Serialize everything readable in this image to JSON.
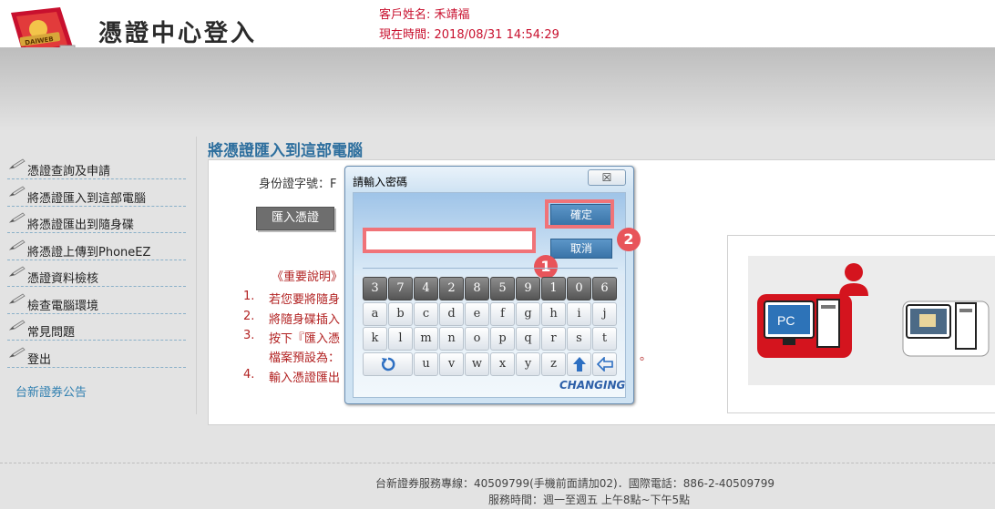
{
  "header": {
    "logo_text": "DAIWEB",
    "title": "憑證中心登入",
    "customer_label": "客戶姓名: 禾靖福",
    "time_label": "現在時間: 2018/08/31 14:54:29"
  },
  "sidebar": {
    "items": [
      {
        "label": "憑證查詢及申請"
      },
      {
        "label": "將憑證匯入到這部電腦"
      },
      {
        "label": "將憑證匯出到隨身碟"
      },
      {
        "label": "將憑證上傳到PhoneEZ"
      },
      {
        "label": "憑證資料檢核"
      },
      {
        "label": "檢查電腦環境"
      },
      {
        "label": "常見問題"
      },
      {
        "label": "登出"
      }
    ],
    "announcement": "台新證券公告"
  },
  "main": {
    "title": "將憑證匯入到這部電腦",
    "id_label": "身份證字號：F",
    "import_button": "匯入憑證",
    "notes_title": "《重要說明》",
    "notes": [
      {
        "num": "1.",
        "text": "若您要將隨身"
      },
      {
        "num": "2.",
        "text": "將隨身碟插入"
      },
      {
        "num": "3.",
        "text": "按下『匯入憑"
      },
      {
        "num": "",
        "text": "檔案預設為："
      },
      {
        "num": "4.",
        "text": "輸入憑證匯出"
      }
    ],
    "note_tail": "。",
    "illustration": {
      "pc_label": "PC"
    }
  },
  "dialog": {
    "title": "請輸入密碼",
    "close_glyph": "☒",
    "ok": "確定",
    "cancel": "取消",
    "password_value": "",
    "badges": [
      "1",
      "2"
    ],
    "digits": [
      "3",
      "7",
      "4",
      "2",
      "8",
      "5",
      "9",
      "1",
      "0",
      "6"
    ],
    "row2": [
      "a",
      "b",
      "c",
      "d",
      "e",
      "f",
      "g",
      "h",
      "i",
      "j"
    ],
    "row3": [
      "k",
      "l",
      "m",
      "n",
      "o",
      "p",
      "q",
      "r",
      "s",
      "t"
    ],
    "row4": [
      "u",
      "v",
      "w",
      "x",
      "y",
      "z"
    ],
    "brand": "CHANGING"
  },
  "footer": {
    "line1": "台新證券服務專線：40509799(手機前面請加02)．國際電話：886-2-40509799",
    "line2": "服務時間：週一至週五 上午8點~下午5點"
  },
  "colors": {
    "accent_red": "#c8102e",
    "highlight": "#f07378",
    "link_blue": "#2e6f9e"
  }
}
